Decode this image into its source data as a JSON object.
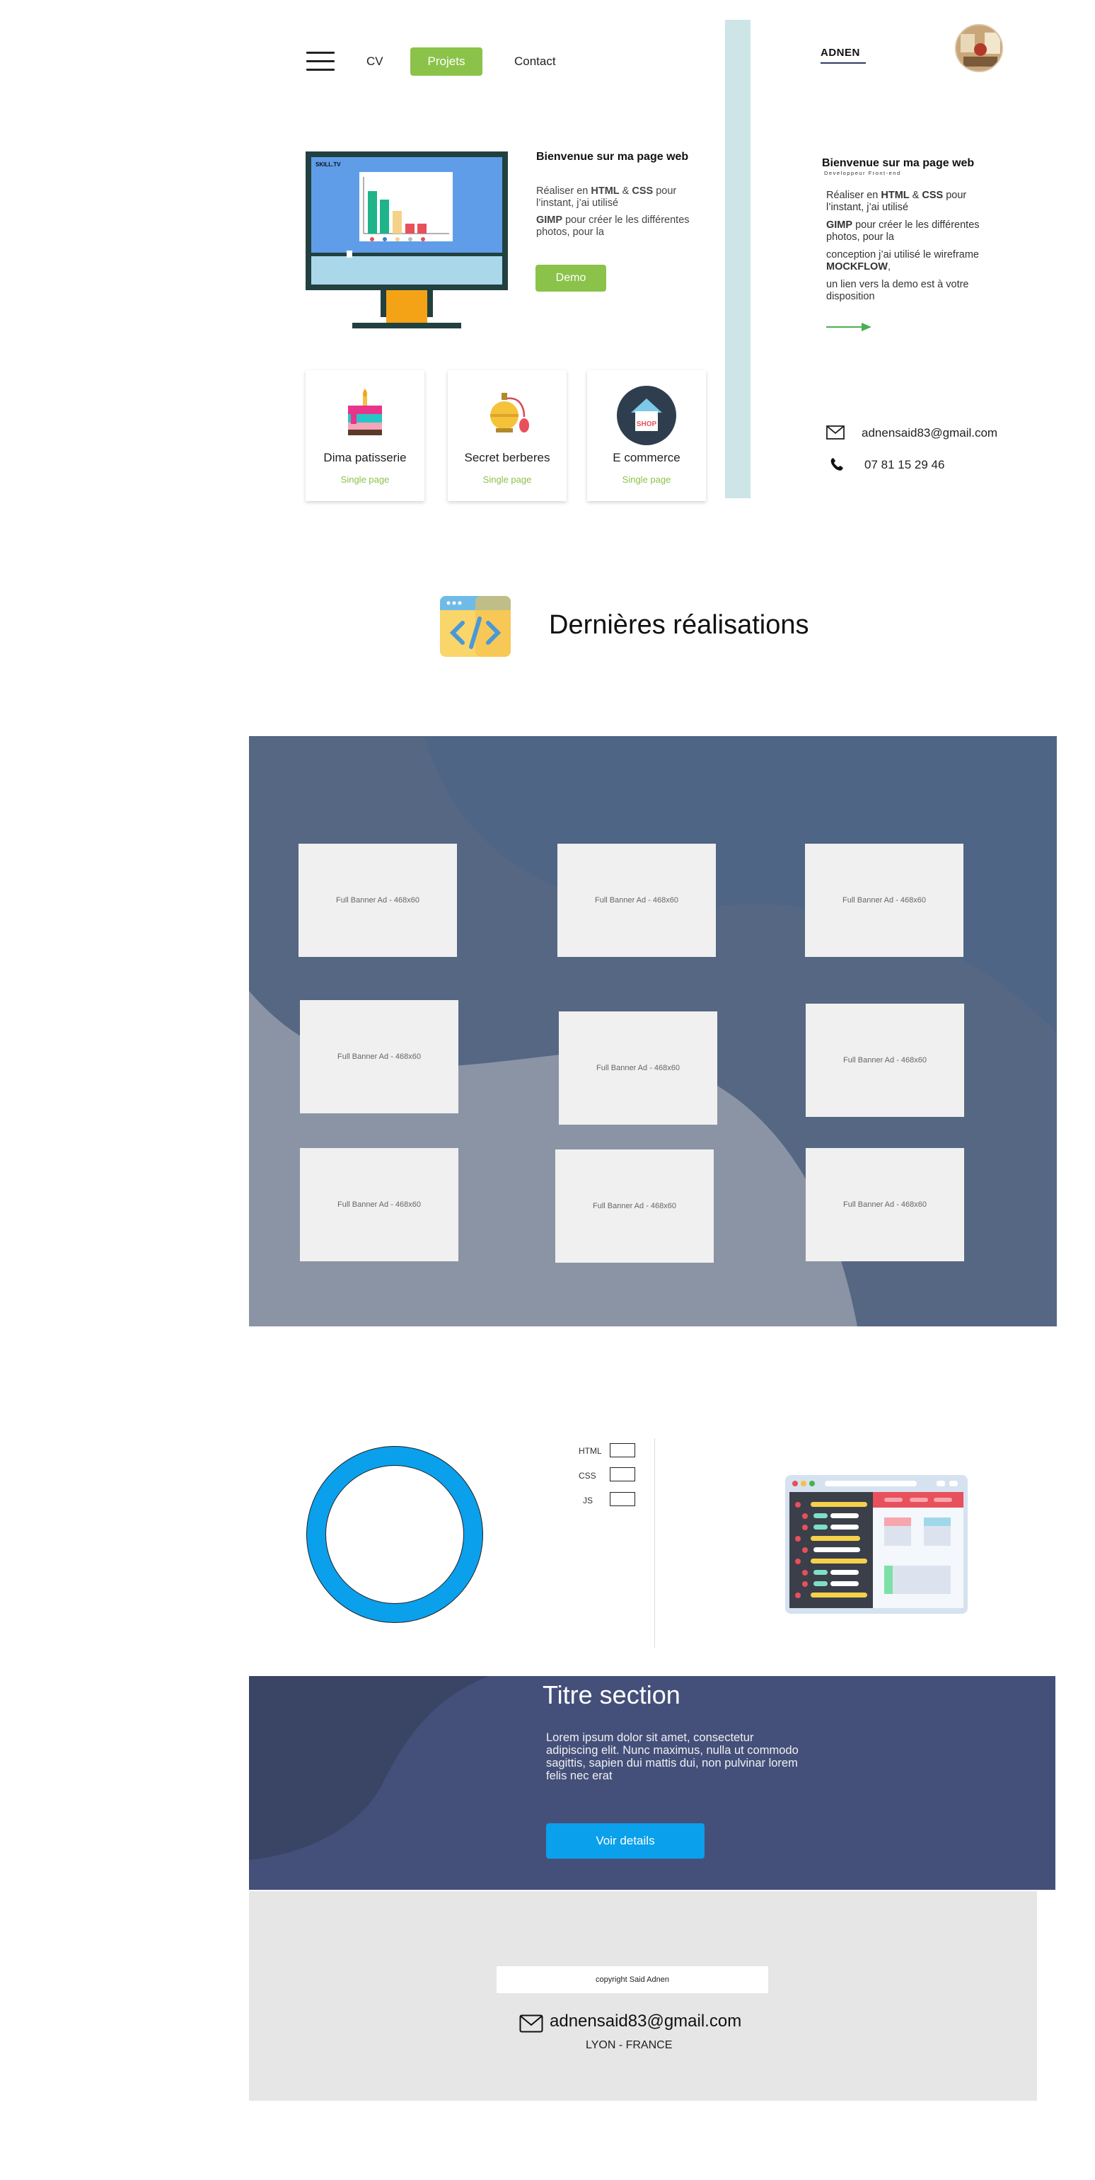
{
  "nav": {
    "items": [
      {
        "label": "CV"
      },
      {
        "label": "Projets"
      },
      {
        "label": "Contact"
      }
    ],
    "brand": "ADNEN"
  },
  "hero": {
    "screen_label": "SKILL.TV",
    "title": "Bienvenue sur ma page web",
    "line1_pre": "Réaliser en ",
    "line1_html": "HTML",
    "line1_amp": " & ",
    "line1_css": "CSS",
    "line1_post": " pour",
    "line2": "l’instant, j’ai utilisé",
    "line3_bold": "GIMP",
    "line3_post": " pour créer le les différentes",
    "line4": "photos, pour la",
    "demo_label": "Demo"
  },
  "cards": [
    {
      "title": "Dima patisserie",
      "sub": "Single page"
    },
    {
      "title": "Secret berberes",
      "sub": "Single page"
    },
    {
      "title": "E commerce",
      "sub": "Single page",
      "icon_text": "SHOP"
    }
  ],
  "sidebar": {
    "title": "Bienvenue sur ma page web",
    "subtitle": "Developpeur Front-end",
    "line1_pre": "Réaliser en ",
    "line1_html": "HTML",
    "line1_amp": " & ",
    "line1_css": "CSS",
    "line1_post": " pour",
    "line2": "l’instant, j’ai utilisé",
    "line3_bold": "GIMP",
    "line3_post": " pour créer le les différentes",
    "line4": "photos, pour la",
    "line5": "conception j’ai utilisé le wireframe",
    "line6_bold": "MOCKFLOW",
    "line6_post": ",",
    "line7": "un lien vers la demo est à votre",
    "line8": "disposition",
    "email": "adnensaid83@gmail.com",
    "phone": "07 81 15 29 46"
  },
  "realisations": {
    "heading": "Dernières réalisations",
    "ads": [
      "Full Banner Ad - 468x60",
      "Full Banner Ad - 468x60",
      "Full Banner Ad - 468x60",
      "Full Banner Ad - 468x60",
      "Full Banner Ad - 468x60",
      "Full Banner Ad - 468x60",
      "Full Banner Ad - 468x60",
      "Full Banner Ad - 468x60",
      "Full Banner Ad - 468x60"
    ]
  },
  "skills": {
    "items": [
      {
        "label": "HTML"
      },
      {
        "label": "CSS"
      },
      {
        "label": "JS"
      }
    ]
  },
  "band": {
    "title": "Titre section",
    "text": "Lorem ipsum dolor sit amet, consectetur adipiscing elit. Nunc maximus, nulla ut commodo sagittis, sapien dui mattis dui, non pulvinar lorem felis nec erat",
    "button": "Voir details"
  },
  "footer": {
    "copyright": "copyright Said Adnen",
    "email": "adnensaid83@gmail.com",
    "city": "LYON - FRANCE"
  },
  "colors": {
    "accent_green": "#8bc34a",
    "accent_blue": "#0aa0ec",
    "band_bg": "#44507a",
    "gallery_bg": "#5a6b8a",
    "divider_teal": "#cde5e7"
  }
}
